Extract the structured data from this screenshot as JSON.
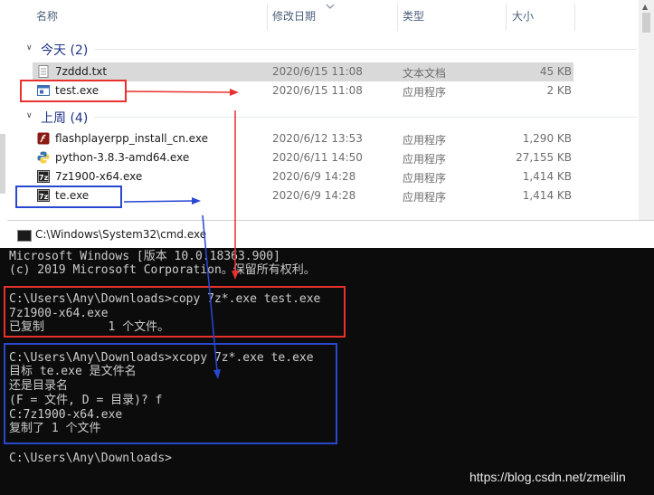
{
  "explorer": {
    "columns": {
      "name": "名称",
      "modified": "修改日期",
      "type": "类型",
      "size": "大小"
    },
    "groups": [
      {
        "label": "今天 (2)",
        "files": [
          {
            "name": "7zddd.txt",
            "date": "2020/6/15 11:08",
            "type": "文本文档",
            "size": "45 KB",
            "icon": "text-file-icon"
          },
          {
            "name": "test.exe",
            "date": "2020/6/15 11:08",
            "type": "应用程序",
            "size": "2 KB",
            "icon": "exe-window-icon"
          }
        ]
      },
      {
        "label": "上周 (4)",
        "files": [
          {
            "name": "flashplayerpp_install_cn.exe",
            "date": "2020/6/12 13:53",
            "type": "应用程序",
            "size": "1,290 KB",
            "icon": "flash-icon"
          },
          {
            "name": "python-3.8.3-amd64.exe",
            "date": "2020/6/11 14:50",
            "type": "应用程序",
            "size": "27,155 KB",
            "icon": "python-icon"
          },
          {
            "name": "7z1900-x64.exe",
            "date": "2020/6/9 14:28",
            "type": "应用程序",
            "size": "1,414 KB",
            "icon": "7zip-icon"
          },
          {
            "name": "te.exe",
            "date": "2020/6/9 14:28",
            "type": "应用程序",
            "size": "1,414 KB",
            "icon": "7zip-icon"
          }
        ]
      }
    ]
  },
  "cmd": {
    "title": "C:\\Windows\\System32\\cmd.exe",
    "lines": [
      "Microsoft Windows [版本 10.0.18363.900]",
      "(c) 2019 Microsoft Corporation。保留所有权利。",
      "",
      "C:\\Users\\Any\\Downloads>copy 7z*.exe test.exe",
      "7z1900-x64.exe",
      "已复制         1 个文件。",
      "",
      "C:\\Users\\Any\\Downloads>xcopy 7z*.exe te.exe",
      "目标 te.exe 是文件名",
      "还是目录名",
      "(F = 文件, D = 目录)? f",
      "C:7z1900-x64.exe",
      "复制了 1 个文件",
      "",
      "C:\\Users\\Any\\Downloads>"
    ]
  },
  "watermark": "https://blog.csdn.net/zmeilin",
  "colors": {
    "highlight_red": "#e8312d",
    "highlight_blue": "#2848d0",
    "console_bg": "#0c0c0c",
    "console_fg": "#cccccc",
    "group_header": "#1e3287",
    "selected_row": "#d9d9d9"
  }
}
